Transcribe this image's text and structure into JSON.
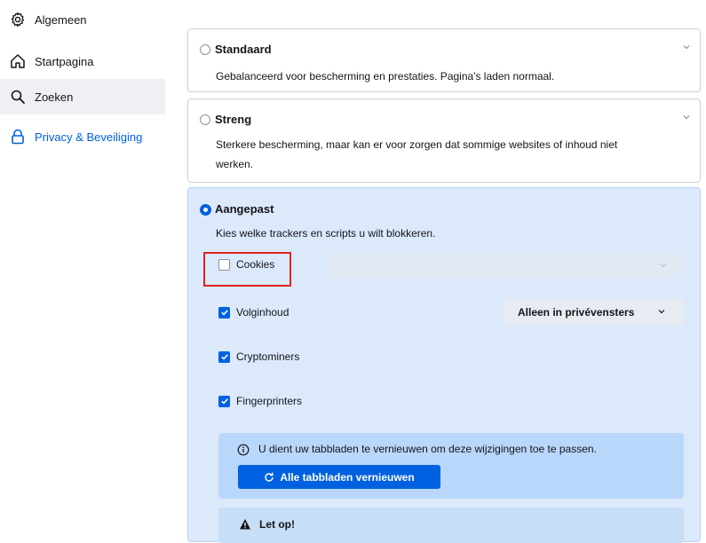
{
  "sidebar": {
    "items": [
      {
        "label": "Algemeen",
        "icon": "gear-icon"
      },
      {
        "label": "Startpagina",
        "icon": "home-icon"
      },
      {
        "label": "Zoeken",
        "icon": "search-icon"
      },
      {
        "label": "Privacy & Beveiliging",
        "icon": "lock-icon"
      }
    ]
  },
  "protection": {
    "standard": {
      "title": "Standaard",
      "description": "Gebalanceerd voor bescherming en prestaties. Pagina's laden normaal."
    },
    "strict": {
      "title": "Streng",
      "description_line1": "Sterkere bescherming, maar kan er voor zorgen dat sommige websites of inhoud niet",
      "description_line2": "werken."
    },
    "custom": {
      "title": "Aangepast",
      "subtitle": "Kies welke trackers en scripts u wilt blokkeren.",
      "options": [
        {
          "label": "Cookies",
          "checked": false
        },
        {
          "label": "Volginhoud",
          "checked": true
        },
        {
          "label": "Cryptominers",
          "checked": true
        },
        {
          "label": "Fingerprinters",
          "checked": true
        }
      ],
      "tracking_select_value": "Alleen in privévensters",
      "cookies_select_value": "",
      "notice": "U dient uw tabbladen te vernieuwen om deze wijzigingen toe te passen.",
      "reload_button": "Alle tabbladen vernieuwen",
      "warning_title": "Let op!"
    }
  },
  "colors": {
    "accent": "#0061e0",
    "custom_bg": "#dbe9fb",
    "highlight": "#e02121"
  }
}
